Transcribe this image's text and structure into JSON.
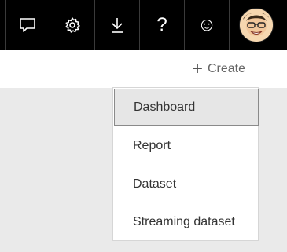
{
  "topbar": {
    "icons": [
      {
        "name": "feedback-icon"
      },
      {
        "name": "settings-gear-icon"
      },
      {
        "name": "download-icon"
      },
      {
        "name": "help-icon",
        "glyph": "?"
      },
      {
        "name": "smiley-icon",
        "glyph": "☺"
      }
    ],
    "avatar": {
      "name": "user-avatar"
    }
  },
  "toolbar": {
    "create_plus": "+",
    "create_label": "Create"
  },
  "create_menu": {
    "items": [
      {
        "label": "Dashboard",
        "selected": true
      },
      {
        "label": "Report"
      },
      {
        "label": "Dataset"
      },
      {
        "label": "Streaming dataset"
      }
    ]
  }
}
